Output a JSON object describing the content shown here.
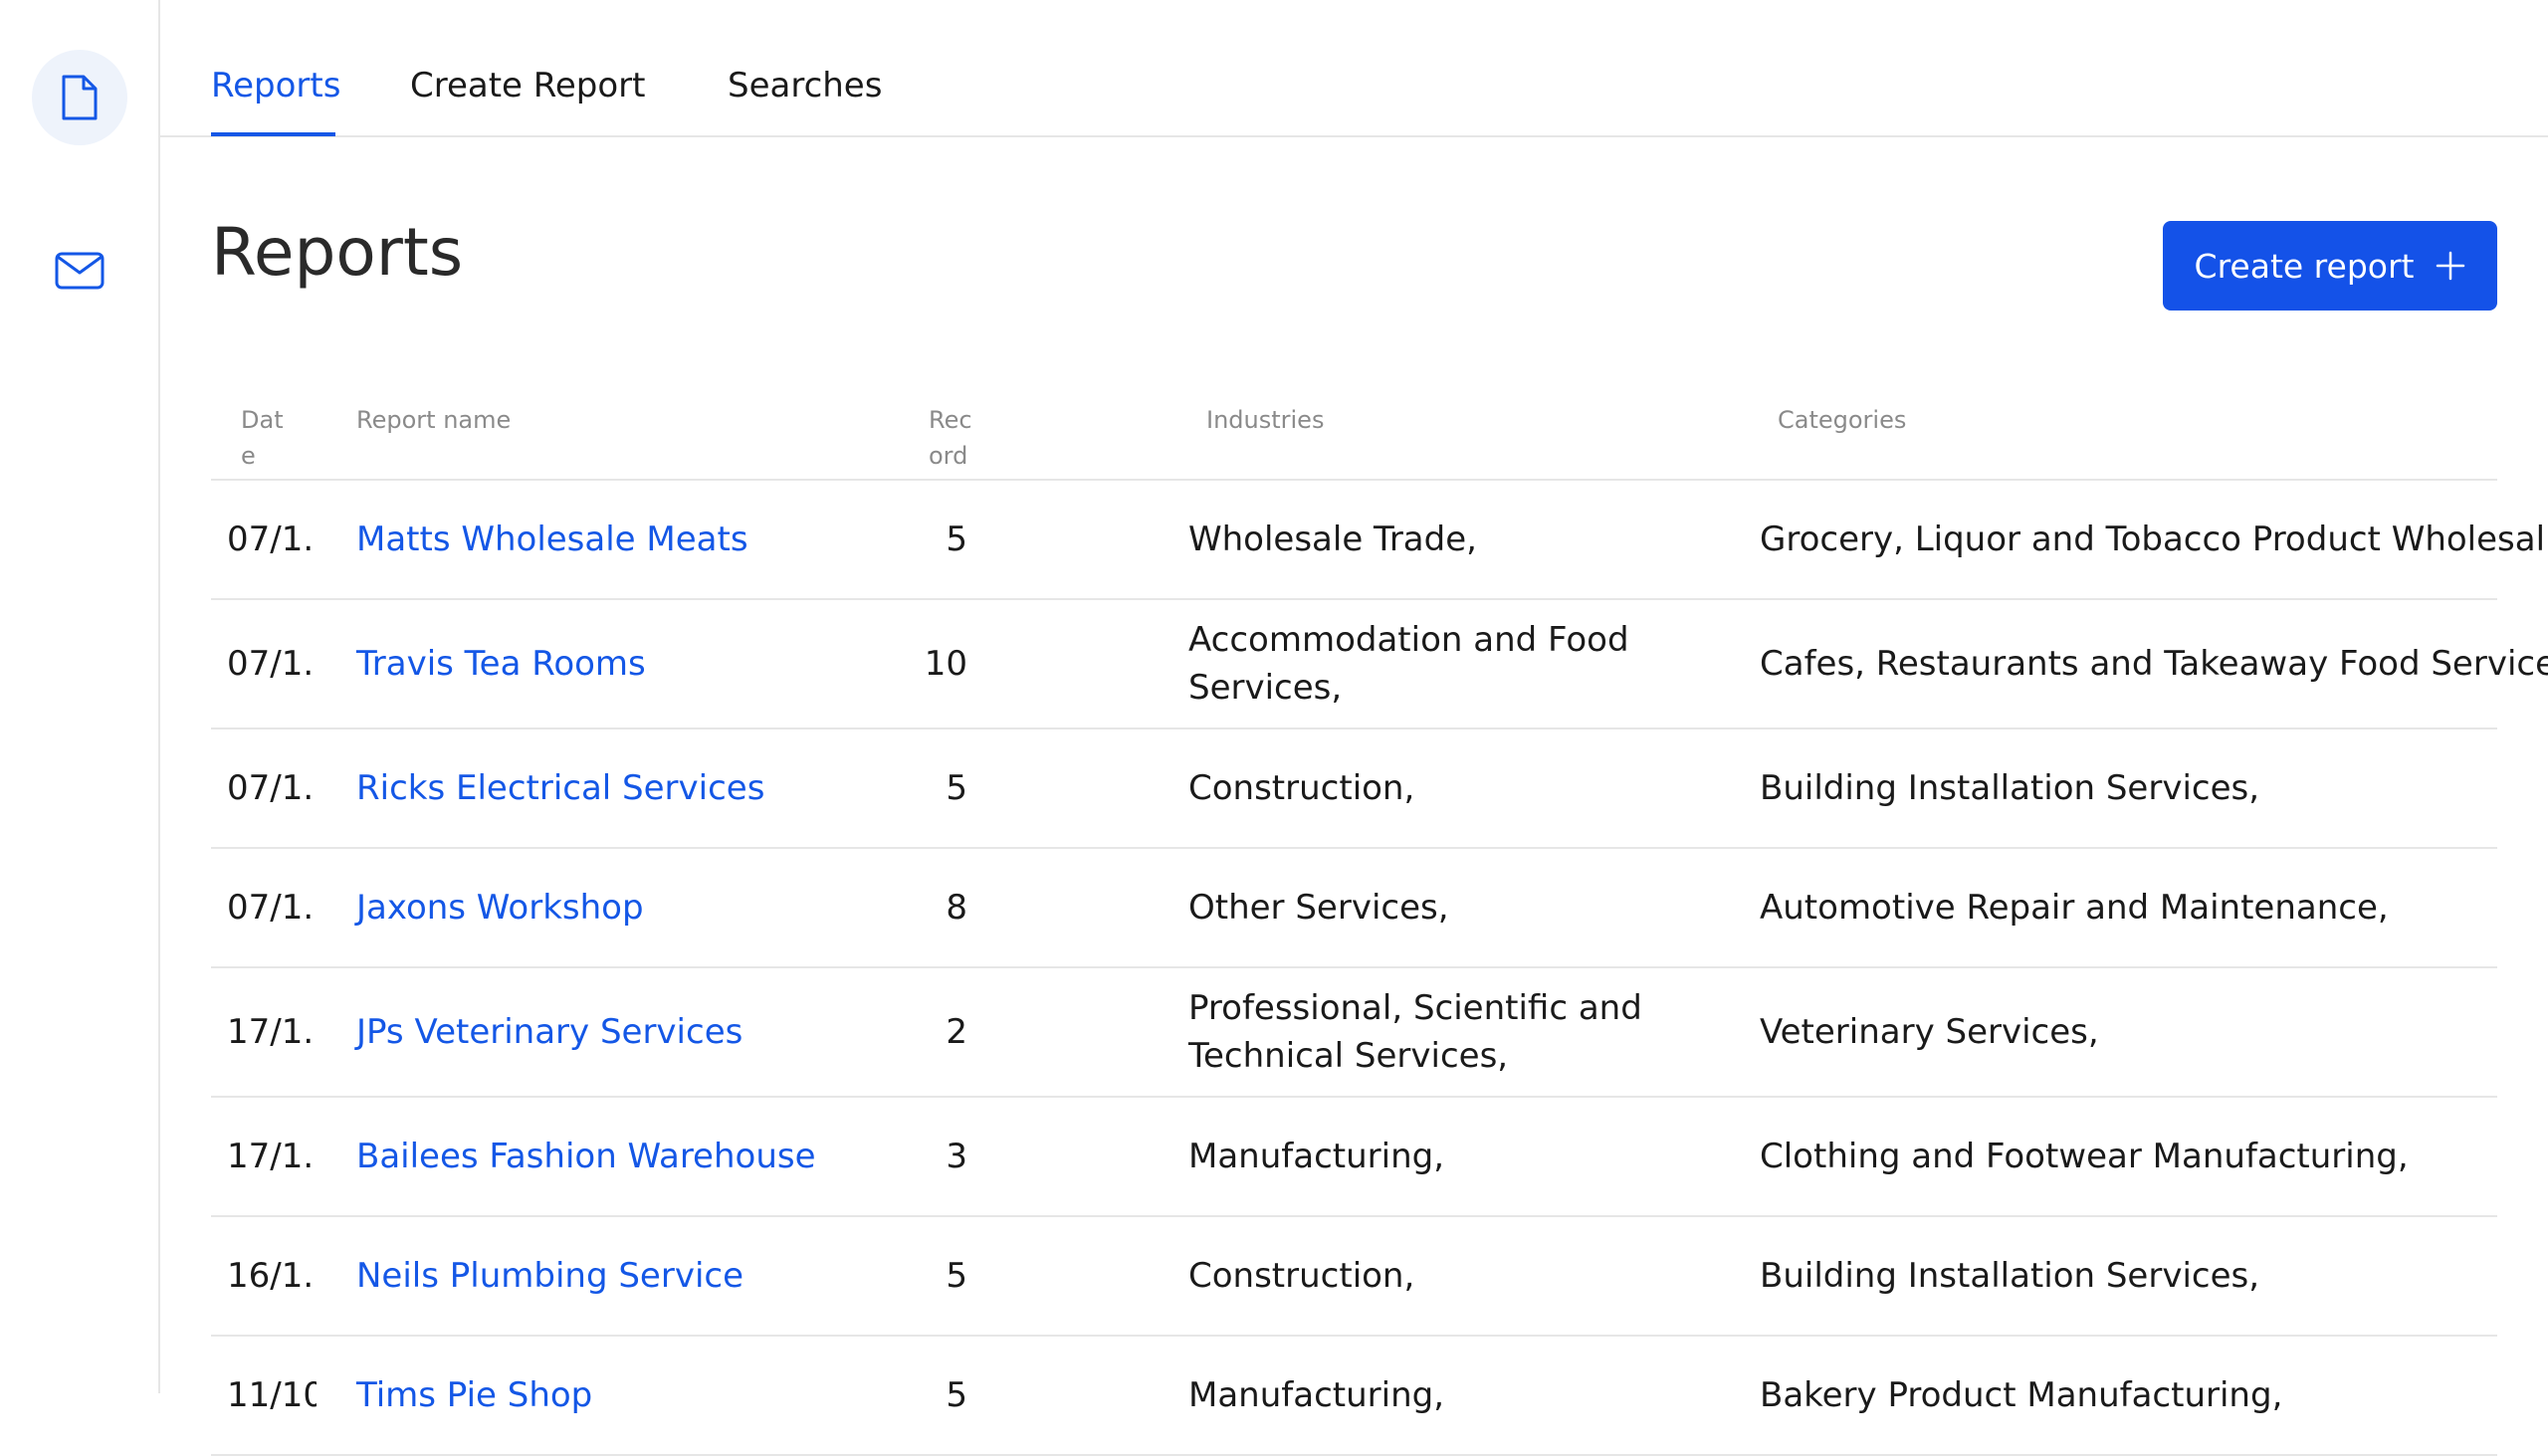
{
  "nav": {
    "tabs": [
      {
        "label": "Reports"
      },
      {
        "label": "Create Report"
      },
      {
        "label": "Searches"
      }
    ]
  },
  "page": {
    "title": "Reports",
    "create_button_label": "Create report"
  },
  "table": {
    "headers": {
      "date": "Date",
      "name": "Report name",
      "records": "Record",
      "industries": "Industries",
      "categories": "Categories"
    },
    "rows": [
      {
        "date": "07/1...",
        "name": "Matts Wholesale Meats",
        "records": "5",
        "industries": "Wholesale Trade,",
        "categories": "Grocery, Liquor and Tobacco Product Wholesaling,"
      },
      {
        "date": "07/1...",
        "name": "Travis Tea Rooms",
        "records": "10",
        "industries": "Accommodation and Food Services,",
        "categories": "Cafes, Restaurants and Takeaway Food Services,"
      },
      {
        "date": "07/1...",
        "name": "Ricks Electrical Services",
        "records": "5",
        "industries": "Construction,",
        "categories": "Building Installation Services,"
      },
      {
        "date": "07/1...",
        "name": "Jaxons Workshop",
        "records": "8",
        "industries": "Other Services,",
        "categories": "Automotive Repair and Maintenance,"
      },
      {
        "date": "17/1...",
        "name": "JPs Veterinary Services",
        "records": "2",
        "industries": "Professional, Scientific and Technical Services,",
        "categories": "Veterinary Services,"
      },
      {
        "date": "17/1...",
        "name": "Bailees Fashion Warehouse",
        "records": "3",
        "industries": "Manufacturing,",
        "categories": "Clothing and Footwear Manufacturing,"
      },
      {
        "date": "16/1...",
        "name": "Neils Plumbing Service",
        "records": "5",
        "industries": "Construction,",
        "categories": "Building Installation Services,"
      },
      {
        "date": "11/10...",
        "name": "Tims Pie Shop",
        "records": "5",
        "industries": "Manufacturing,",
        "categories": "Bakery Product Manufacturing,"
      }
    ]
  },
  "icons": {
    "sidebar_reports": "document-icon",
    "sidebar_messages": "mail-icon",
    "create_button": "plus-icon"
  },
  "colors": {
    "accent": "#1457e6",
    "button": "#1452e8",
    "active_icon_bg": "#eef3fb"
  }
}
